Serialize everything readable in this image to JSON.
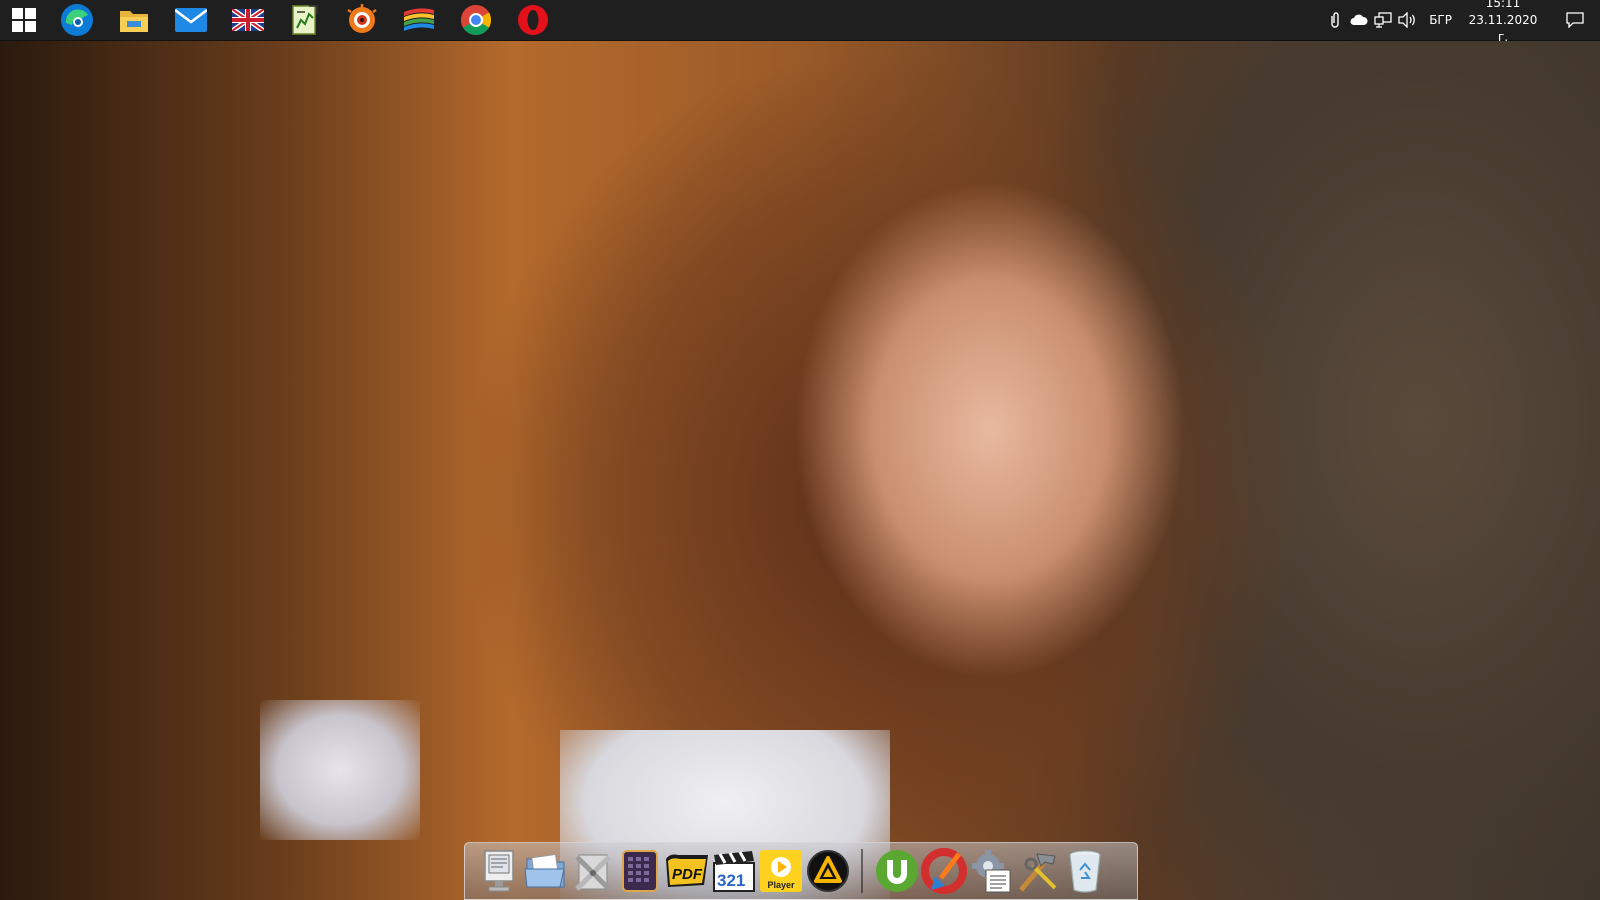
{
  "taskbar": {
    "pinned": [
      {
        "name": "start-button",
        "icon": "windows-logo-icon"
      },
      {
        "name": "edge-taskbar-icon",
        "icon": "edge-icon"
      },
      {
        "name": "file-explorer-taskbar-icon",
        "icon": "folder-icon"
      },
      {
        "name": "mail-taskbar-icon",
        "icon": "mail-icon"
      },
      {
        "name": "uk-flag-taskbar-icon",
        "icon": "uk-flag-icon"
      },
      {
        "name": "notepad-chart-taskbar-icon",
        "icon": "document-chart-icon"
      },
      {
        "name": "xnview-taskbar-icon",
        "icon": "eye-icon"
      },
      {
        "name": "stacked-layers-taskbar-icon",
        "icon": "layers-icon"
      },
      {
        "name": "chrome-taskbar-icon",
        "icon": "chrome-icon"
      },
      {
        "name": "opera-taskbar-icon",
        "icon": "opera-icon"
      }
    ],
    "tray": {
      "language": "БГР",
      "time": "15:11",
      "date": "23.11.2020 г.",
      "icons": [
        "paperclip-icon",
        "onedrive-cloud-icon",
        "network-icon",
        "volume-icon"
      ]
    }
  },
  "dock": {
    "player_label": "Player",
    "pdf_label": "PDF",
    "counter_label": "321",
    "left_group": [
      "computer-icon",
      "folder-open-icon",
      "system-tools-icon",
      "calculator-icon",
      "pdf-icon",
      "clapperboard-icon",
      "media-player-icon",
      "aimp-icon"
    ],
    "right_group": [
      "utorrent-icon",
      "ccleaner-icon",
      "settings-gear-icon",
      "tools-hammer-icon",
      "recycle-bin-icon"
    ]
  },
  "colors": {
    "taskbar_bg": "#1f1f1f",
    "tray_text": "#ffffff"
  }
}
